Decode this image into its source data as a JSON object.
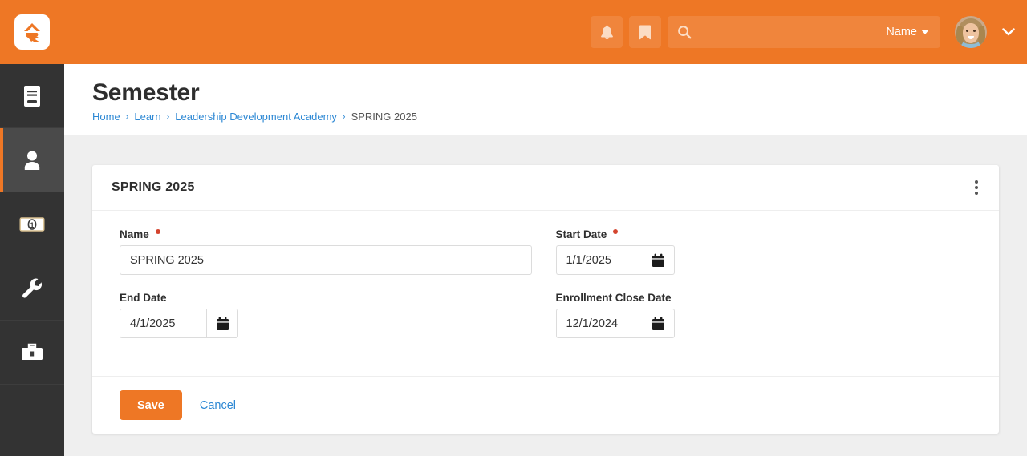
{
  "colors": {
    "brand_orange": "#ee7725",
    "sidebar_dark": "#333333",
    "link_blue": "#2d88d4",
    "required_red": "#d4442e",
    "content_gray": "#efefef"
  },
  "topbar": {
    "logo_name": "rock-logo",
    "notifications_icon": "bell-icon",
    "bookmarks_icon": "bookmark-icon",
    "search": {
      "icon": "search-icon",
      "value": "",
      "placeholder": "",
      "scope_label": "Name",
      "scope_caret_icon": "caret-down-icon"
    },
    "avatar_name": "user-avatar",
    "user_menu_icon": "chevron-down-icon"
  },
  "sidebar": {
    "items": [
      {
        "icon": "book-icon",
        "name": "sidebar-item-cms",
        "active": false
      },
      {
        "icon": "person-icon",
        "name": "sidebar-item-people",
        "active": true
      },
      {
        "icon": "money-bill-icon",
        "name": "sidebar-item-finance",
        "active": false
      },
      {
        "icon": "wrench-icon",
        "name": "sidebar-item-admin",
        "active": false
      },
      {
        "icon": "briefcase-icon",
        "name": "sidebar-item-tools",
        "active": false
      }
    ]
  },
  "page": {
    "title": "Semester",
    "breadcrumb": [
      {
        "label": "Home",
        "link": true
      },
      {
        "label": "Learn",
        "link": true
      },
      {
        "label": "Leadership Development Academy",
        "link": true
      },
      {
        "label": "SPRING 2025",
        "link": false
      }
    ],
    "breadcrumb_separator": "›"
  },
  "panel": {
    "title": "SPRING 2025",
    "menu_icon": "kebab-menu-icon",
    "fields": {
      "name": {
        "label": "Name",
        "required": true,
        "value": "SPRING 2025",
        "placeholder": ""
      },
      "start_date": {
        "label": "Start Date",
        "required": true,
        "value": "1/1/2025",
        "placeholder": "",
        "picker_icon": "calendar-icon"
      },
      "end_date": {
        "label": "End Date",
        "required": false,
        "value": "4/1/2025",
        "placeholder": "",
        "picker_icon": "calendar-icon"
      },
      "enrollment_close_date": {
        "label": "Enrollment Close Date",
        "required": false,
        "value": "12/1/2024",
        "placeholder": "",
        "picker_icon": "calendar-icon"
      }
    },
    "footer": {
      "save_label": "Save",
      "cancel_label": "Cancel"
    }
  }
}
